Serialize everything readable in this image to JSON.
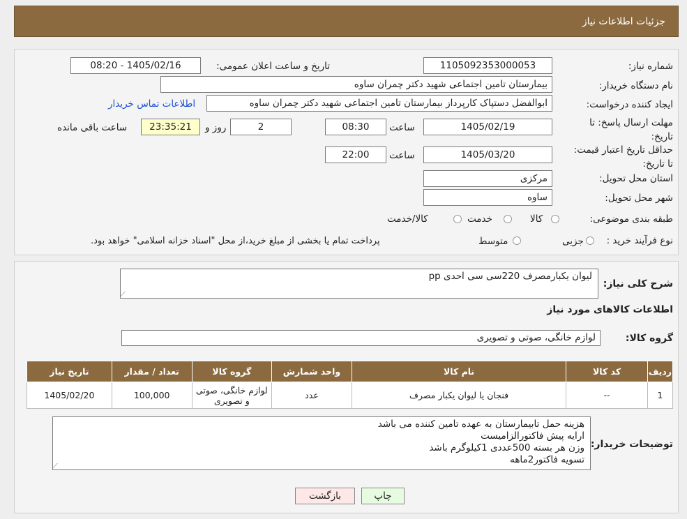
{
  "header": {
    "title": "جزئیات اطلاعات نیاز"
  },
  "form": {
    "need_number_label": "شماره نیاز:",
    "need_number": "1105092353000053",
    "announce_label": "تاریخ و ساعت اعلان عمومی:",
    "announce_value": "1405/02/16 - 08:20",
    "buyer_org_label": "نام دستگاه خریدار:",
    "buyer_org": "بیمارستان تامین اجتماعی شهید دکتر چمران ساوه",
    "requester_label": "ایجاد کننده درخواست:",
    "requester": "ابوالفضل  دستپاک  کارپرداز بیمارستان تامین اجتماعی شهید دکتر چمران ساوه",
    "contact_link": "اطلاعات تماس خریدار",
    "reply_deadline_label": "مهلت ارسال پاسخ: تا تاریخ:",
    "reply_date": "1405/02/19",
    "time_label": "ساعت",
    "reply_time": "08:30",
    "days_value": "2",
    "days_label": "روز و",
    "remaining_time": "23:35:21",
    "remaining_label": "ساعت باقی مانده",
    "validity_label": "حداقل تاریخ اعتبار قیمت: تا تاریخ:",
    "validity_date": "1405/03/20",
    "validity_time": "22:00",
    "province_label": "استان محل تحویل:",
    "province": "مرکزی",
    "city_label": "شهر محل تحویل:",
    "city": "ساوه",
    "category_label": "طبقه بندی موضوعی:",
    "category_options": [
      "کالا",
      "خدمت",
      "کالا/خدمت"
    ],
    "process_label": "نوع فرآیند خرید :",
    "process_options": [
      "جزیی",
      "متوسط"
    ],
    "process_note": "پرداخت تمام یا بخشی از مبلغ خرید،از محل \"اسناد خزانه اسلامی\" خواهد بود."
  },
  "summary": {
    "label": "شرح کلی نیاز:",
    "value": "لیوان یکبارمصرف 220سی سی احدی pp"
  },
  "goods": {
    "section_title": "اطلاعات کالاهای مورد نیاز",
    "group_label": "گروه کالا:",
    "group_value": "لوازم خانگی، صوتی و تصویری",
    "columns": [
      "ردیف",
      "کد کالا",
      "نام کالا",
      "واحد شمارش",
      "گروه کالا",
      "تعداد / مقدار",
      "تاریخ نیاز"
    ],
    "rows": [
      [
        "1",
        "--",
        "فنجان یا لیوان یکبار مصرف",
        "عدد",
        "لوازم خانگی، صوتی و تصویری",
        "100,000",
        "1405/02/20"
      ]
    ]
  },
  "buyer_notes": {
    "label": "توضیحات خریدار:",
    "lines": [
      "هزینه حمل تابیمارستان به عهده تامین کننده می باشد",
      "ارایه پیش فاکتورالزامیست",
      "وزن هر بسته 500عددی 1کیلوگرم باشد",
      "تسویه فاکتور2ماهه"
    ]
  },
  "buttons": {
    "print": "چاپ",
    "back": "بازگشت"
  },
  "colors": {
    "header_bg": "#8b6a40",
    "print_bg": "#e7fbe0",
    "back_bg": "#fde7e7",
    "link": "#1a4fd6"
  }
}
